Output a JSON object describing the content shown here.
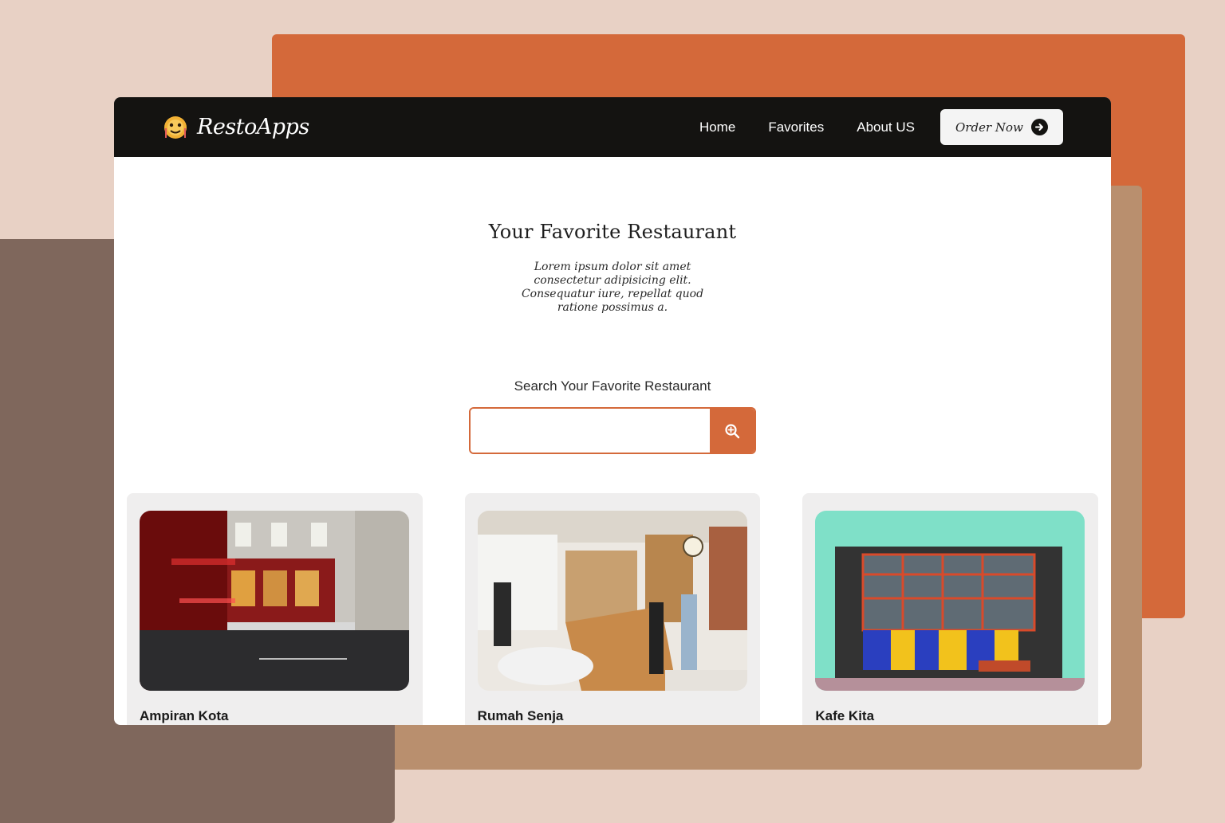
{
  "brand": {
    "name": "RestoApps",
    "logo_icon": "chef-mascot-icon"
  },
  "nav": {
    "links": [
      "Home",
      "Favorites",
      "About US"
    ],
    "order_button": "Order Now",
    "order_icon": "arrow-right-circle-icon"
  },
  "hero": {
    "title": "Your Favorite Restaurant",
    "description": "Lorem ipsum dolor sit amet consectetur adipisicing elit. Consequatur iure, repellat quod ratione possimus a."
  },
  "search": {
    "label": "Search Your Favorite Restaurant",
    "value": "",
    "placeholder": "",
    "button_icon": "search-icon"
  },
  "restaurants": [
    {
      "name": "Ampiran Kota",
      "image": "street-pub-photo"
    },
    {
      "name": "Rumah Senja",
      "image": "cafe-interior-photo"
    },
    {
      "name": "Kafe Kita",
      "image": "colorful-storefront-photo"
    }
  ],
  "colors": {
    "accent": "#d4693a",
    "navbar": "#141311",
    "background": "#e8d1c5",
    "deco_tan": "#b98f6e",
    "deco_brown": "#7f675c"
  }
}
